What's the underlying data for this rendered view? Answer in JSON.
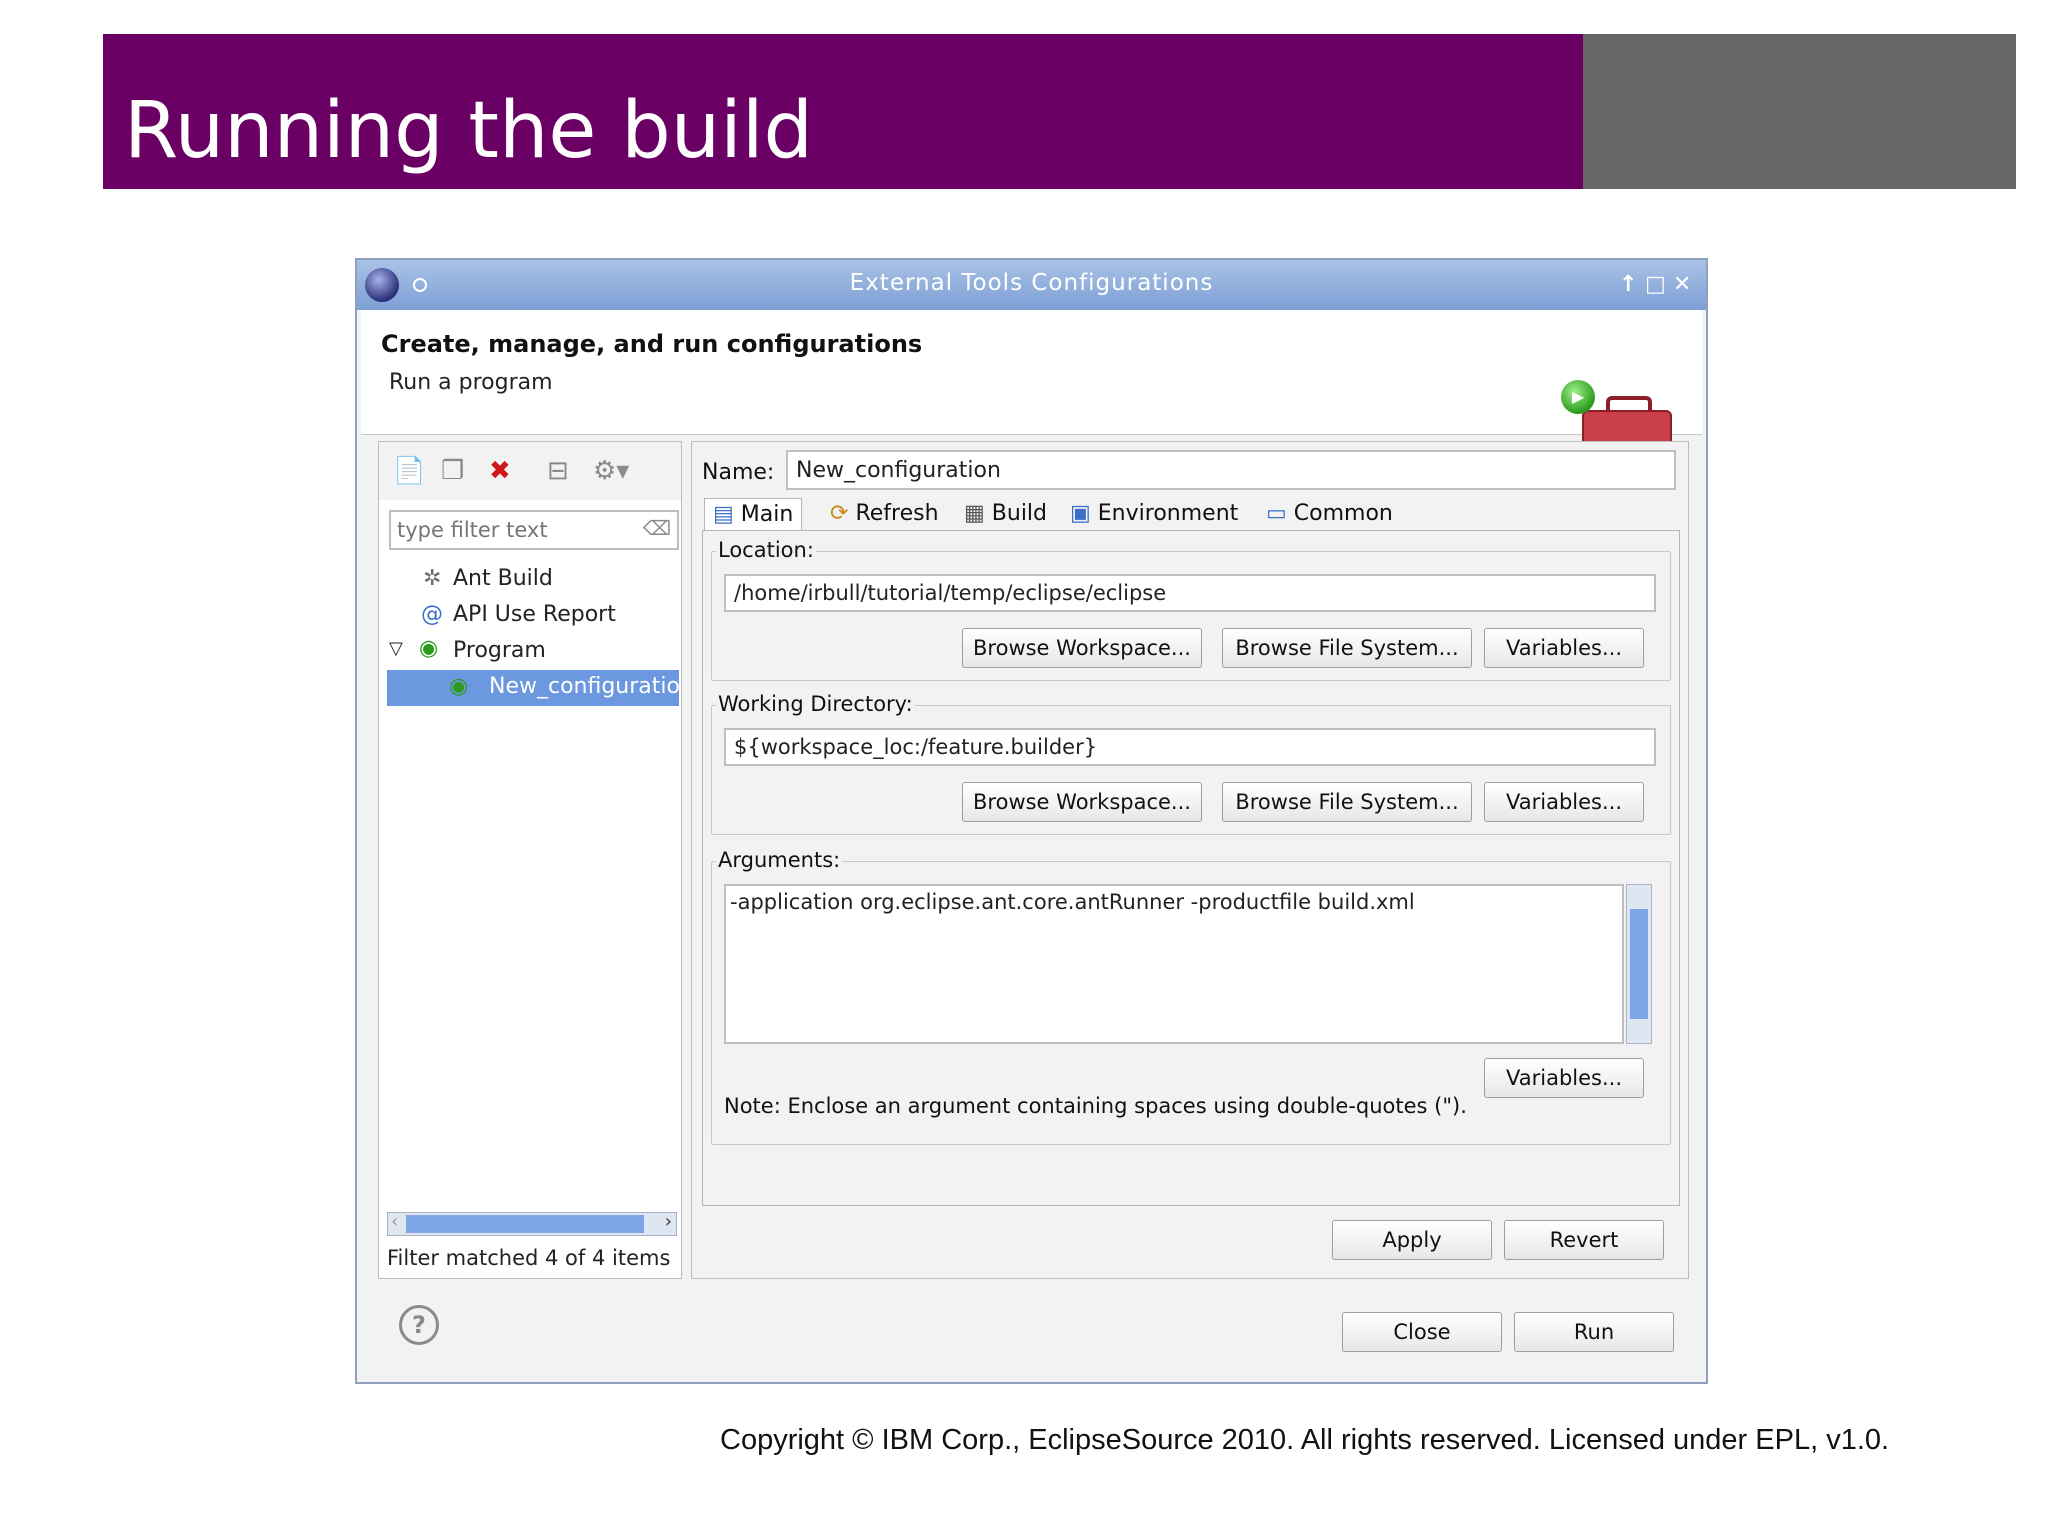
{
  "slide": {
    "title": "Running the build",
    "copyright": "Copyright © IBM Corp., EclipseSource 2010. All rights reserved.  Licensed under EPL, v1.0."
  },
  "window": {
    "title": "External Tools Configurations",
    "controls": [
      "↑",
      "□",
      "✕"
    ]
  },
  "banner": {
    "title": "Create, manage, and run configurations",
    "subtitle": "Run a program"
  },
  "left": {
    "filter_placeholder": "type filter text",
    "tree": [
      {
        "label": "Ant Build",
        "icon": "ant-icon"
      },
      {
        "label": "API Use Report",
        "icon": "api-report-icon"
      },
      {
        "label": "Program",
        "icon": "program-icon"
      },
      {
        "label": "New_configuratio",
        "icon": "program-config-icon",
        "selected": true
      }
    ],
    "status": "Filter matched 4 of 4 items"
  },
  "right": {
    "name_label": "Name:",
    "name_value": "New_configuration",
    "tabs": [
      "Main",
      "Refresh",
      "Build",
      "Environment",
      "Common"
    ],
    "location_label": "Location:",
    "location_value": "/home/irbull/tutorial/temp/eclipse/eclipse",
    "workdir_label": "Working Directory:",
    "workdir_value": "${workspace_loc:/feature.builder}",
    "browse_workspace": "Browse Workspace...",
    "browse_filesystem": "Browse File System...",
    "variables": "Variables...",
    "arguments_label": "Arguments:",
    "arguments_value": "-application org.eclipse.ant.core.antRunner -productfile build.xml",
    "note": "Note: Enclose an argument containing spaces using double-quotes (\").",
    "apply": "Apply",
    "revert": "Revert"
  },
  "footer": {
    "close": "Close",
    "run": "Run"
  }
}
